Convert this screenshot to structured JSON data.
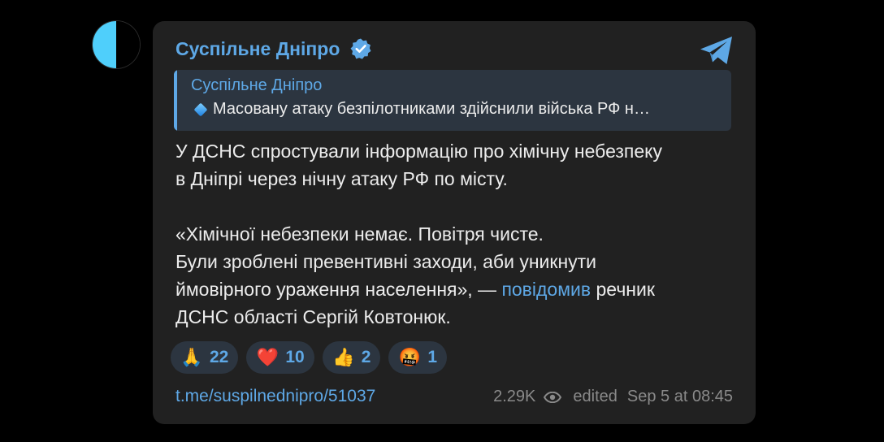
{
  "post": {
    "channel_name": "Суспільне Дніпро",
    "reply": {
      "author": "Суспільне Дніпро",
      "text": "Масовану атаку безпілотниками здійснили війська РФ н…"
    },
    "body": {
      "line1": "У ДСНС спростували інформацію про хімічну небезпеку",
      "line2": "в Дніпрі через нічну атаку РФ по місту.",
      "quote1": "«Хімічної небезпеки немає. Повітря чисте.",
      "quote2": "Були зроблені превентивні заходи, аби уникнути",
      "quote3_pre": "ймовірного ураження населення», — ",
      "quote3_link": "повідомив",
      "quote3_post": " речник",
      "quote4": "ДСНС області Сергій Ковтонюк."
    },
    "reactions": [
      {
        "emoji": "🙏",
        "icon": "folded-hands",
        "count": "22"
      },
      {
        "emoji": "❤️",
        "icon": "red-heart",
        "count": "10"
      },
      {
        "emoji": "👍",
        "icon": "thumbs-up",
        "count": "2"
      },
      {
        "emoji": "🤬",
        "icon": "swearing-face",
        "count": "1"
      }
    ],
    "footer": {
      "link": "t.me/suspilnednipro/51037",
      "views": "2.29K",
      "edited": "edited",
      "date": "Sep 5 at 08:45"
    }
  },
  "colors": {
    "background": "#000000",
    "bubble": "#212121",
    "accent": "#5ea8e6",
    "text": "#ececec",
    "muted": "#8a8a8a",
    "reaction_bg": "#2c3540"
  },
  "icons": {
    "avatar": "half-black-half-blue-circle",
    "verified": "verified-badge-icon",
    "share": "telegram-share-icon",
    "views": "eye-icon"
  }
}
